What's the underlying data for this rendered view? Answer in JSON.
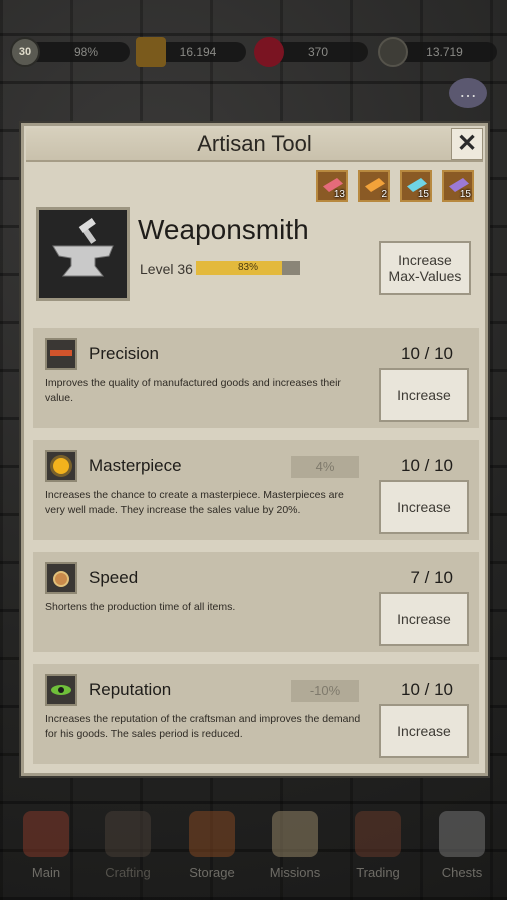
{
  "hud": {
    "level": "30",
    "xp_percent": "98%",
    "gold": "16.194",
    "gems": "370",
    "reputation": "13.719"
  },
  "dialog": {
    "title": "Artisan Tool",
    "close": "✕",
    "materials": [
      {
        "name": "red-material",
        "count": "13",
        "color": "#e56b7a"
      },
      {
        "name": "orange-material",
        "count": "2",
        "color": "#f2a23a"
      },
      {
        "name": "cyan-material",
        "count": "15",
        "color": "#6fd4e6"
      },
      {
        "name": "purple-material",
        "count": "15",
        "color": "#9c7ad6"
      }
    ],
    "profession": "Weaponsmith",
    "level_label": "Level 36",
    "level_progress": 0.83,
    "level_progress_text": "83%",
    "increase_max_button": "Increase\nMax-Values",
    "skills": [
      {
        "name": "Precision",
        "value": "",
        "count": "10 / 10",
        "description": "Improves the quality of manufactured goods and increases their value.",
        "button": "Increase",
        "icon": "ruler-icon"
      },
      {
        "name": "Masterpiece",
        "value": "4%",
        "count": "10 / 10",
        "description": "Increases the chance to create a masterpiece. Masterpieces are very well made. They increase the sales value by 20%.",
        "button": "Increase",
        "icon": "sun-icon"
      },
      {
        "name": "Speed",
        "value": "",
        "count": "7 / 10",
        "description": "Shortens the production time of all items.",
        "button": "Increase",
        "icon": "stopwatch-icon"
      },
      {
        "name": "Reputation",
        "value": "-10%",
        "count": "10 / 10",
        "description": "Increases the reputation of the craftsman and improves the demand for his goods. The sales period is reduced.",
        "button": "Increase",
        "icon": "eye-icon"
      }
    ]
  },
  "nav": {
    "items": [
      {
        "label": "Main"
      },
      {
        "label": "Crafting"
      },
      {
        "label": "Storage"
      },
      {
        "label": "Missions"
      },
      {
        "label": "Trading"
      },
      {
        "label": "Chests"
      }
    ]
  },
  "colors": {
    "dialog_bg": "#d8d2c1",
    "skill_bg": "#c6bfac",
    "progress": "#e3b93c"
  }
}
